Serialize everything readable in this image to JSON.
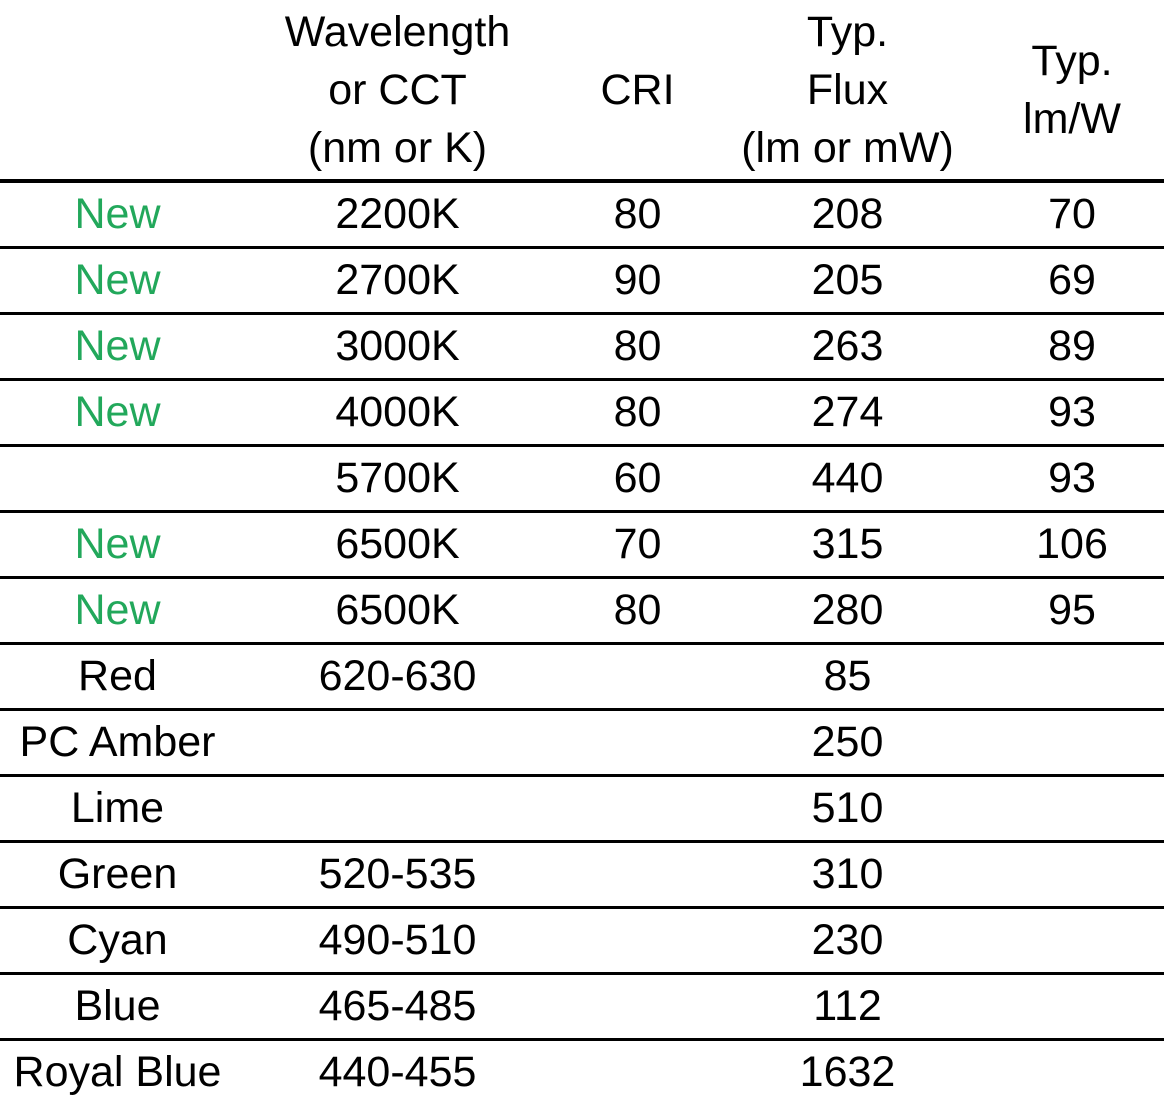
{
  "table": {
    "headers": [
      {
        "id": "type",
        "lines": [
          ""
        ]
      },
      {
        "id": "wavelength_cct",
        "lines": [
          "Wavelength",
          "or CCT",
          "(nm or K)"
        ]
      },
      {
        "id": "cri",
        "lines": [
          "CRI"
        ]
      },
      {
        "id": "typ_flux",
        "lines": [
          "Typ.",
          "Flux",
          "(lm or mW)"
        ]
      },
      {
        "id": "typ_lm_per_w",
        "lines": [
          "Typ.",
          "lm/W"
        ]
      }
    ],
    "new_badge_color": "#22A85B",
    "rule_color": "#000000",
    "rows": [
      {
        "type": "New",
        "is_new": true,
        "wavelength_cct": "2200K",
        "cri": "80",
        "typ_flux": "208",
        "typ_lm_per_w": "70"
      },
      {
        "type": "New",
        "is_new": true,
        "wavelength_cct": "2700K",
        "cri": "90",
        "typ_flux": "205",
        "typ_lm_per_w": "69"
      },
      {
        "type": "New",
        "is_new": true,
        "wavelength_cct": "3000K",
        "cri": "80",
        "typ_flux": "263",
        "typ_lm_per_w": "89"
      },
      {
        "type": "New",
        "is_new": true,
        "wavelength_cct": "4000K",
        "cri": "80",
        "typ_flux": "274",
        "typ_lm_per_w": "93"
      },
      {
        "type": "",
        "is_new": false,
        "wavelength_cct": "5700K",
        "cri": "60",
        "typ_flux": "440",
        "typ_lm_per_w": "93"
      },
      {
        "type": "New",
        "is_new": true,
        "wavelength_cct": "6500K",
        "cri": "70",
        "typ_flux": "315",
        "typ_lm_per_w": "106"
      },
      {
        "type": "New",
        "is_new": true,
        "wavelength_cct": "6500K",
        "cri": "80",
        "typ_flux": "280",
        "typ_lm_per_w": "95"
      },
      {
        "type": "Red",
        "is_new": false,
        "wavelength_cct": "620-630",
        "cri": "",
        "typ_flux": "85",
        "typ_lm_per_w": ""
      },
      {
        "type": "PC Amber",
        "is_new": false,
        "wavelength_cct": "",
        "cri": "",
        "typ_flux": "250",
        "typ_lm_per_w": ""
      },
      {
        "type": "Lime",
        "is_new": false,
        "wavelength_cct": "",
        "cri": "",
        "typ_flux": "510",
        "typ_lm_per_w": ""
      },
      {
        "type": "Green",
        "is_new": false,
        "wavelength_cct": "520-535",
        "cri": "",
        "typ_flux": "310",
        "typ_lm_per_w": ""
      },
      {
        "type": "Cyan",
        "is_new": false,
        "wavelength_cct": "490-510",
        "cri": "",
        "typ_flux": "230",
        "typ_lm_per_w": ""
      },
      {
        "type": "Blue",
        "is_new": false,
        "wavelength_cct": "465-485",
        "cri": "",
        "typ_flux": "112",
        "typ_lm_per_w": ""
      },
      {
        "type": "Royal Blue",
        "is_new": false,
        "wavelength_cct": "440-455",
        "cri": "",
        "typ_flux": "1632",
        "typ_lm_per_w": ""
      }
    ]
  }
}
